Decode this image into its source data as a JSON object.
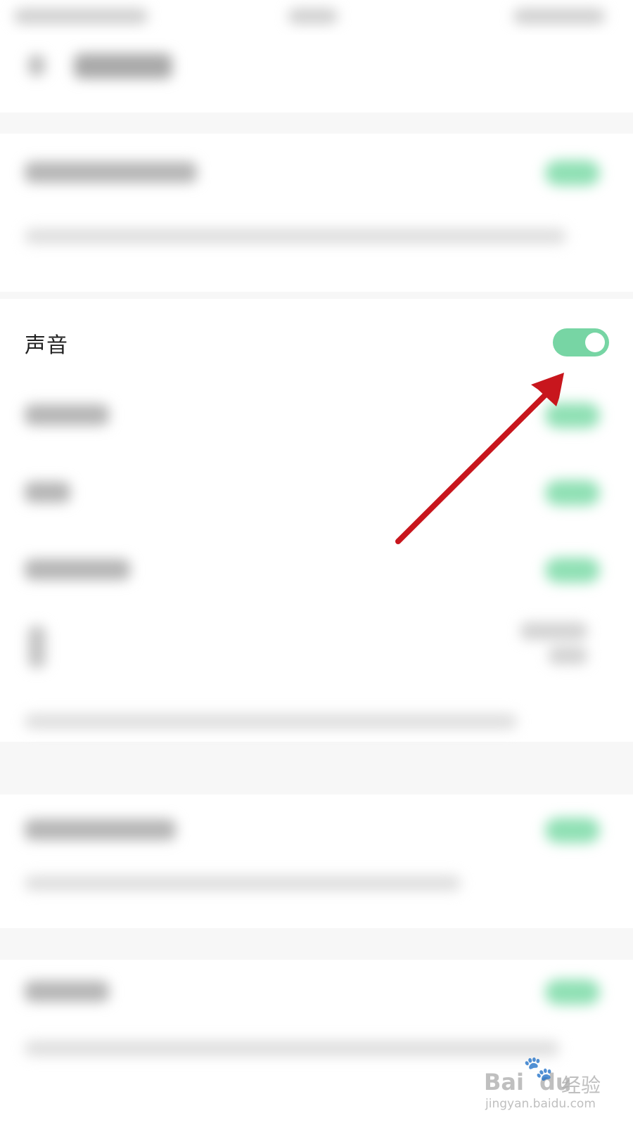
{
  "sound_setting": {
    "label": "声音",
    "enabled": true
  },
  "colors": {
    "toggle_on": "#77d5a4",
    "arrow": "#c8161d"
  },
  "watermark": {
    "brand": "Bai",
    "brand_suffix": "du",
    "product": "经验",
    "url": "jingyan.baidu.com"
  }
}
